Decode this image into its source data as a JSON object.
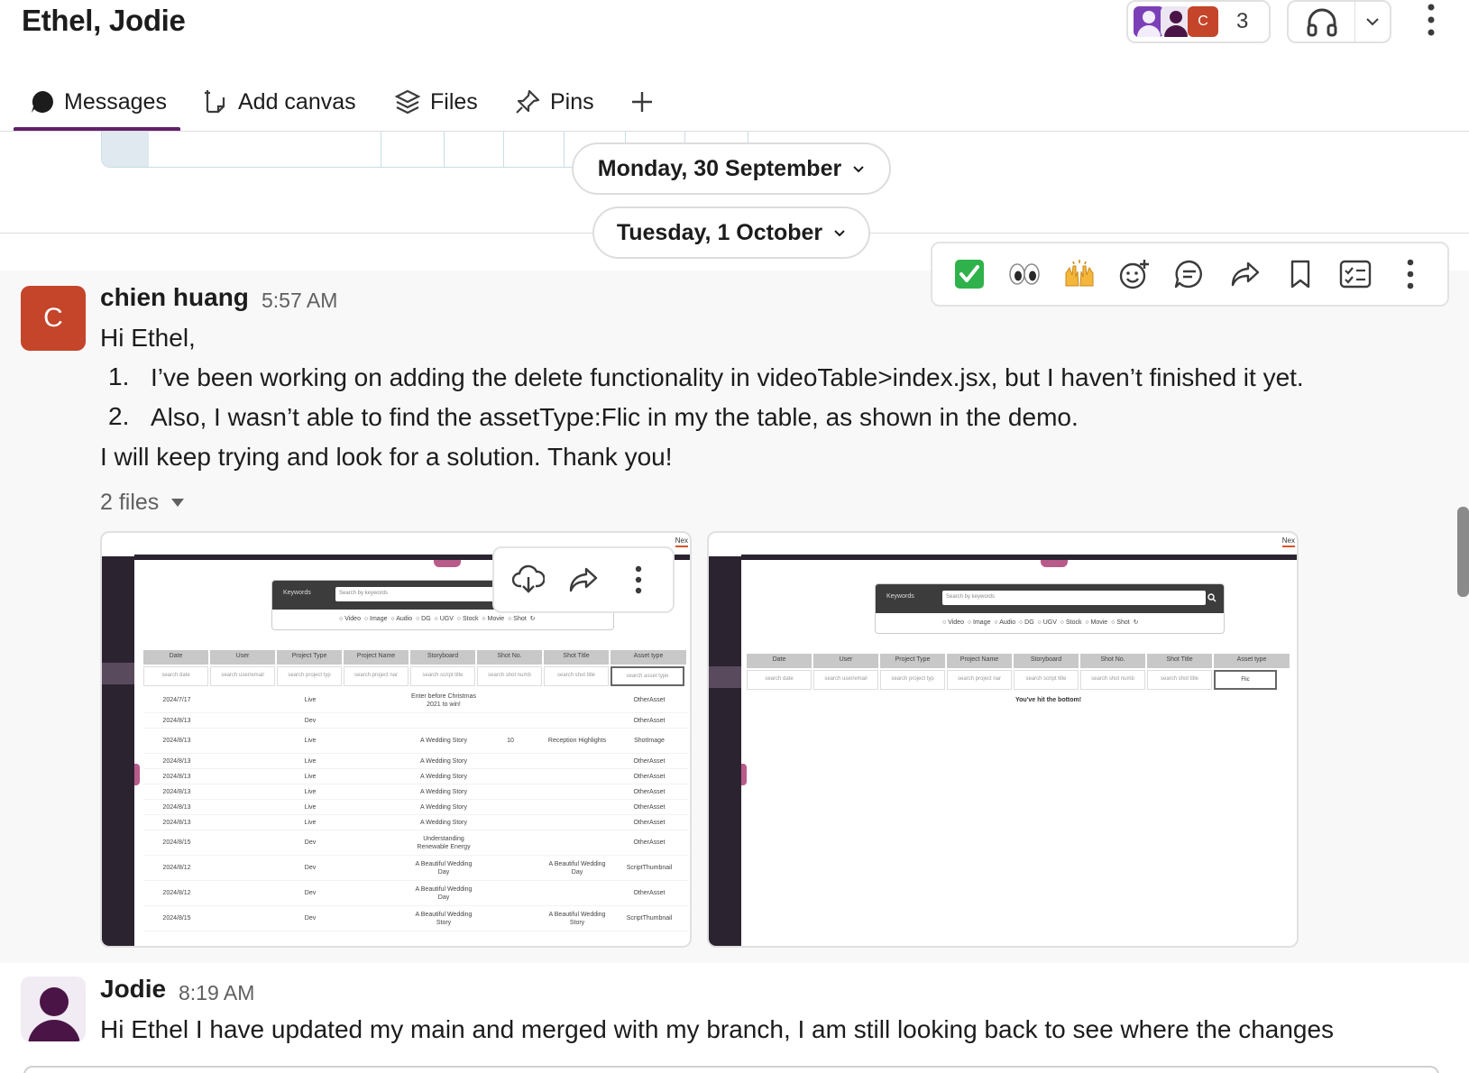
{
  "header": {
    "title": "Ethel, Jodie",
    "member_avatar_initial": "C",
    "member_count": "3"
  },
  "tabs": [
    {
      "label": "Messages",
      "icon": "message-bubble-icon",
      "active": true
    },
    {
      "label": "Add canvas",
      "icon": "canvas-add-icon"
    },
    {
      "label": "Files",
      "icon": "files-stack-icon"
    },
    {
      "label": "Pins",
      "icon": "pin-icon"
    }
  ],
  "date_dividers": [
    "Monday, 30 September",
    "Tuesday, 1 October"
  ],
  "hover_toolbar": {
    "reactions": [
      "✅",
      "👀",
      "🙌"
    ],
    "actions": [
      "add-reaction-icon",
      "reply-in-thread-icon",
      "forward-icon",
      "bookmark-icon",
      "create-task-icon",
      "more-actions-icon"
    ]
  },
  "message1": {
    "avatar_initial": "C",
    "sender": "chien huang",
    "time": "5:57 AM",
    "greeting": "Hi Ethel,",
    "list": [
      "I’ve been working on adding the delete functionality in videoTable>index.jsx, but I haven’t finished it yet.",
      "Also, I wasn’t able to find the assetType:Flic in my the table, as shown in the demo."
    ],
    "closing": "I will keep trying and look for a solution. Thank you!",
    "files_label": "2 files"
  },
  "attachment_ui": {
    "search_dropdown": "Keywords",
    "search_placeholder": "Search by keywords",
    "radio_options": [
      "Video",
      "Image",
      "Audio",
      "DG",
      "UGV",
      "Stock",
      "Movie",
      "Shot"
    ],
    "columns": [
      "Date",
      "User",
      "Project Type",
      "Project Name",
      "Storyboard",
      "Shot No.",
      "Shot Title",
      "Asset type"
    ],
    "filter_placeholders": [
      "search date",
      "search user/email",
      "search project typ",
      "search project nar",
      "search script title",
      "search shot numb",
      "search shot title",
      "search asset type"
    ],
    "corner_label": "Nex",
    "rows": [
      {
        "date": "2024/7/17",
        "project_type": "Live",
        "storyboard": "Enter before Christmas 2021 to win!",
        "shot_no": "",
        "shot_title": "",
        "asset": "OtherAsset"
      },
      {
        "date": "2024/8/13",
        "project_type": "Dev",
        "storyboard": "",
        "shot_no": "",
        "shot_title": "",
        "asset": "OtherAsset"
      },
      {
        "date": "2024/8/13",
        "project_type": "Live",
        "storyboard": "A Wedding Story",
        "shot_no": "10",
        "shot_title": "Reception Highlights",
        "asset": "ShotImage"
      },
      {
        "date": "2024/8/13",
        "project_type": "Live",
        "storyboard": "A Wedding Story",
        "shot_no": "",
        "shot_title": "",
        "asset": "OtherAsset"
      },
      {
        "date": "2024/8/13",
        "project_type": "Live",
        "storyboard": "A Wedding Story",
        "shot_no": "",
        "shot_title": "",
        "asset": "OtherAsset"
      },
      {
        "date": "2024/8/13",
        "project_type": "Live",
        "storyboard": "A Wedding Story",
        "shot_no": "",
        "shot_title": "",
        "asset": "OtherAsset"
      },
      {
        "date": "2024/8/13",
        "project_type": "Live",
        "storyboard": "A Wedding Story",
        "shot_no": "",
        "shot_title": "",
        "asset": "OtherAsset"
      },
      {
        "date": "2024/8/13",
        "project_type": "Live",
        "storyboard": "A Wedding Story",
        "shot_no": "",
        "shot_title": "",
        "asset": "OtherAsset"
      },
      {
        "date": "2024/8/15",
        "project_type": "Dev",
        "storyboard": "Understanding Renewable Energy",
        "shot_no": "",
        "shot_title": "",
        "asset": "OtherAsset"
      },
      {
        "date": "2024/8/12",
        "project_type": "Dev",
        "storyboard": "A Beautiful Wedding Day",
        "shot_no": "",
        "shot_title": "A Beautiful Wedding Day",
        "asset": "ScriptThumbnail"
      },
      {
        "date": "2024/8/12",
        "project_type": "Dev",
        "storyboard": "A Beautiful Wedding Day",
        "shot_no": "",
        "shot_title": "",
        "asset": "OtherAsset"
      },
      {
        "date": "2024/8/15",
        "project_type": "Dev",
        "storyboard": "A Beautiful Wedding Story",
        "shot_no": "",
        "shot_title": "A Beautiful Wedding Story",
        "asset": "ScriptThumbnail"
      }
    ],
    "second_filter_value": "Flic",
    "bottom_message": "You've hit the bottom!"
  },
  "file_actions": [
    "download-icon",
    "share-icon",
    "more-icon"
  ],
  "message2": {
    "sender": "Jodie",
    "time": "8:19 AM",
    "text": "Hi Ethel I have updated my main and merged with my branch, I am still looking back to see where the changes"
  },
  "colors": {
    "accent": "#611f69",
    "avatar_c": "#c4452a",
    "avatar_jodie": "#4a1546"
  }
}
